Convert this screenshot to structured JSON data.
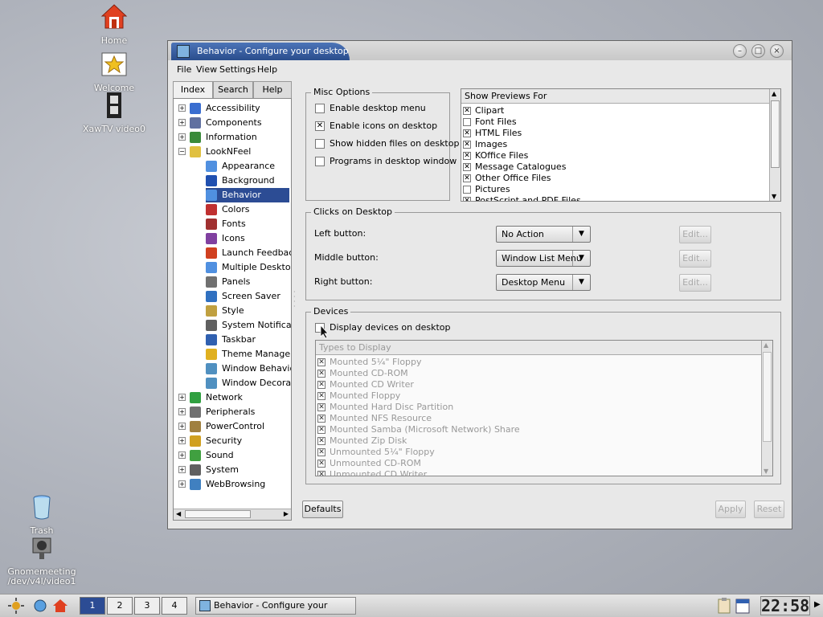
{
  "desktop": {
    "icons": [
      {
        "label": "Home",
        "icon": "home-icon"
      },
      {
        "label": "Welcome",
        "icon": "star-icon"
      },
      {
        "label": "XawTV video0",
        "icon": "film-icon"
      },
      {
        "label": "Trash",
        "icon": "trash-icon"
      },
      {
        "label": "Gnomemeeting /dev/v4l/video1",
        "icon": "camera-icon"
      }
    ]
  },
  "window": {
    "title": "Behavior - Configure your desktop",
    "menu": [
      "File",
      "View",
      "Settings",
      "Help"
    ],
    "tabs": [
      "Index",
      "Search",
      "Help"
    ],
    "tree": [
      {
        "label": "Accessibility",
        "color": "#3a6ed0"
      },
      {
        "label": "Components",
        "color": "#6070a0"
      },
      {
        "label": "Information",
        "color": "#3a8a3a"
      },
      {
        "label": "LookNFeel",
        "color": "#e0c040"
      },
      {
        "label": "Appearance",
        "color": "#5090e0"
      },
      {
        "label": "Background",
        "color": "#2050b0"
      },
      {
        "label": "Behavior",
        "color": "#5090e0"
      },
      {
        "label": "Colors",
        "color": "#c03030"
      },
      {
        "label": "Fonts",
        "color": "#a03030"
      },
      {
        "label": "Icons",
        "color": "#8040a0"
      },
      {
        "label": "Launch Feedback",
        "color": "#d04020"
      },
      {
        "label": "Multiple Desktops",
        "color": "#5090e0"
      },
      {
        "label": "Panels",
        "color": "#707070"
      },
      {
        "label": "Screen Saver",
        "color": "#3070c0"
      },
      {
        "label": "Style",
        "color": "#c0a040"
      },
      {
        "label": "System Notificatio",
        "color": "#606060"
      },
      {
        "label": "Taskbar",
        "color": "#3060b0"
      },
      {
        "label": "Theme Manager",
        "color": "#e0b020"
      },
      {
        "label": "Window Behavior",
        "color": "#5090c0"
      },
      {
        "label": "Window Decoratic",
        "color": "#5090c0"
      },
      {
        "label": "Network",
        "color": "#30a040"
      },
      {
        "label": "Peripherals",
        "color": "#707070"
      },
      {
        "label": "PowerControl",
        "color": "#a08040"
      },
      {
        "label": "Security",
        "color": "#d0a020"
      },
      {
        "label": "Sound",
        "color": "#40a040"
      },
      {
        "label": "System",
        "color": "#606060"
      },
      {
        "label": "WebBrowsing",
        "color": "#4080c0"
      }
    ],
    "misc": {
      "title": "Misc Options",
      "options": [
        {
          "label": "Enable desktop menu",
          "checked": false
        },
        {
          "label": "Enable icons on desktop",
          "checked": true
        },
        {
          "label": "Show hidden files on desktop",
          "checked": false
        },
        {
          "label": "Programs in desktop window",
          "checked": false
        }
      ]
    },
    "previews": {
      "header": "Show Previews For",
      "items": [
        {
          "label": "Clipart",
          "checked": true
        },
        {
          "label": "Font Files",
          "checked": false
        },
        {
          "label": "HTML Files",
          "checked": true
        },
        {
          "label": "Images",
          "checked": true
        },
        {
          "label": "KOffice Files",
          "checked": true
        },
        {
          "label": "Message Catalogues",
          "checked": true
        },
        {
          "label": "Other Office Files",
          "checked": true
        },
        {
          "label": "Pictures",
          "checked": false
        },
        {
          "label": "PostScript and PDF Files",
          "checked": true
        }
      ]
    },
    "clicks": {
      "title": "Clicks on Desktop",
      "rows": [
        {
          "label": "Left button:",
          "value": "No Action",
          "edit": "Edit..."
        },
        {
          "label": "Middle button:",
          "value": "Window List Menu",
          "edit": "Edit..."
        },
        {
          "label": "Right button:",
          "value": "Desktop Menu",
          "edit": "Edit..."
        }
      ]
    },
    "devices": {
      "title": "Devices",
      "display_label": "Display devices on desktop",
      "list_header": "Types to Display",
      "items": [
        "Mounted 5¼\" Floppy",
        "Mounted CD-ROM",
        "Mounted CD Writer",
        "Mounted Floppy",
        "Mounted Hard Disc Partition",
        "Mounted NFS Resource",
        "Mounted Samba (Microsoft Network) Share",
        "Mounted Zip Disk",
        "Unmounted 5¼\" Floppy",
        "Unmounted CD-ROM",
        "Unmounted CD Writer"
      ]
    },
    "buttons": {
      "defaults": "Defaults",
      "apply": "Apply",
      "reset": "Reset"
    }
  },
  "taskbar": {
    "desktops": [
      "1",
      "2",
      "3",
      "4"
    ],
    "task": "Behavior - Configure your desktop",
    "clock": "22:58"
  }
}
